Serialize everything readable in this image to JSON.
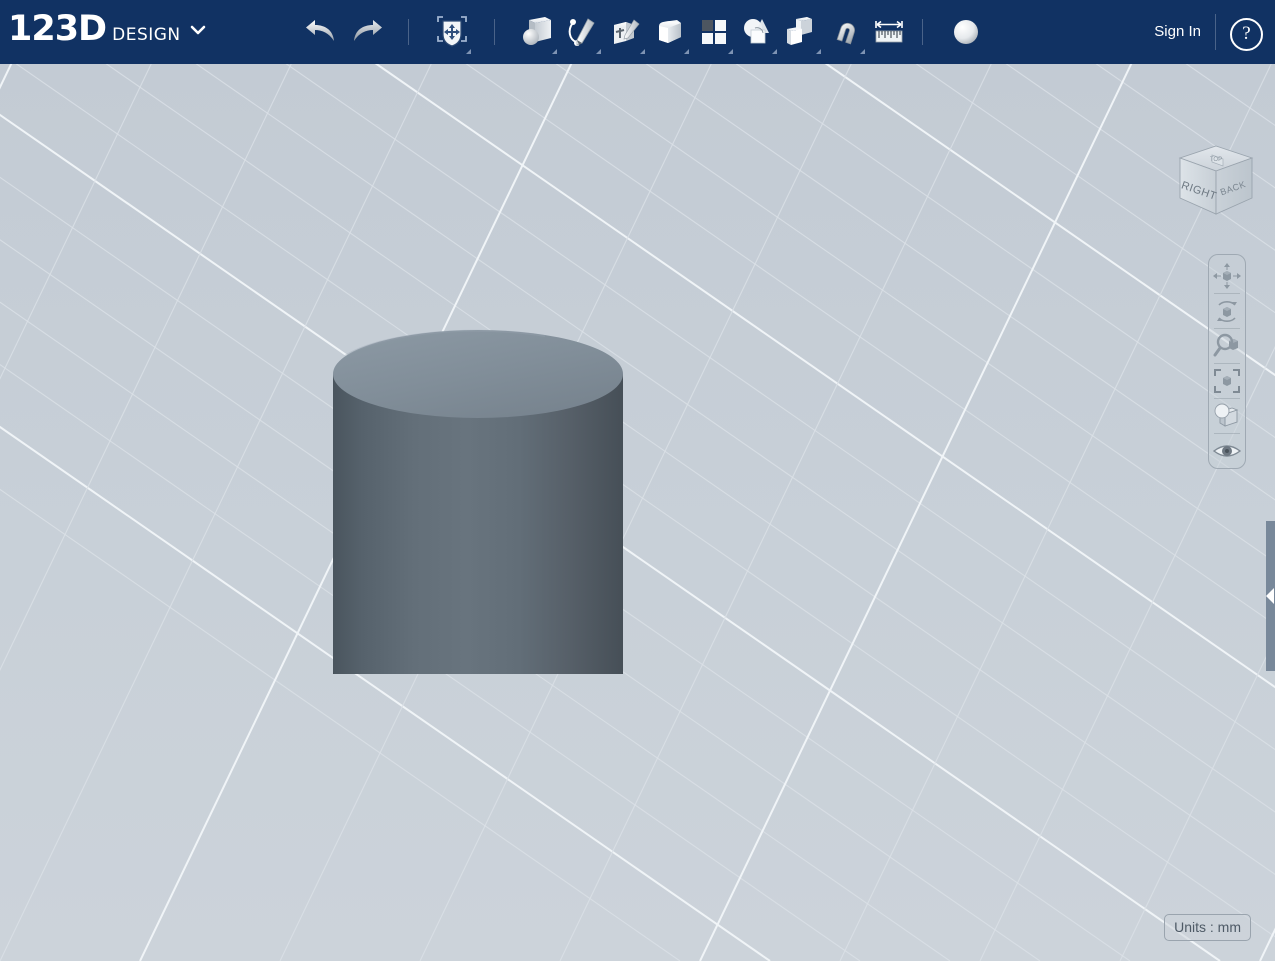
{
  "app": {
    "brand_primary": "123D",
    "brand_secondary": "DESIGN",
    "header_color": "#113263",
    "viewport_bg": "#c8d0d8"
  },
  "header": {
    "logo_menu_icon": "chevron-down-icon",
    "sign_in_label": "Sign In",
    "help_label": "?",
    "history": [
      {
        "name": "undo-button",
        "icon": "undo-arrow-icon",
        "label": "Undo"
      },
      {
        "name": "redo-button",
        "icon": "redo-arrow-icon",
        "label": "Redo"
      }
    ],
    "transform": [
      {
        "name": "transform-button",
        "icon": "move-transform-icon",
        "label": "Transform"
      }
    ],
    "tools": [
      {
        "name": "primitives-button",
        "icon": "primitives-icon",
        "label": "Primitives"
      },
      {
        "name": "sketch-button",
        "icon": "sketch-pencil-icon",
        "label": "Sketch"
      },
      {
        "name": "construct-button",
        "icon": "construct-icon",
        "label": "Construct"
      },
      {
        "name": "modify-button",
        "icon": "modify-box-icon",
        "label": "Modify"
      },
      {
        "name": "pattern-button",
        "icon": "pattern-grid-icon",
        "label": "Pattern"
      },
      {
        "name": "grouping-button",
        "icon": "grouping-shapes-icon",
        "label": "Grouping"
      },
      {
        "name": "combine-button",
        "icon": "combine-boxes-icon",
        "label": "Combine"
      },
      {
        "name": "snap-button",
        "icon": "magnet-snap-icon",
        "label": "Snap"
      },
      {
        "name": "measure-button",
        "icon": "ruler-measure-icon",
        "label": "Measure"
      }
    ],
    "material": [
      {
        "name": "material-button",
        "icon": "material-sphere-icon",
        "label": "Material"
      }
    ]
  },
  "viewcube": {
    "face_right": "RIGHT",
    "face_back": "BACK",
    "face_top": "TOP"
  },
  "navbar": {
    "items": [
      {
        "name": "pan-tool",
        "icon": "pan-arrows-icon",
        "label": "Pan"
      },
      {
        "name": "orbit-tool",
        "icon": "orbit-rotate-icon",
        "label": "Orbit"
      },
      {
        "name": "zoom-tool",
        "icon": "magnifier-zoom-icon",
        "label": "Zoom"
      },
      {
        "name": "fit-tool",
        "icon": "fit-to-view-icon",
        "label": "Fit"
      },
      {
        "name": "view-style-tool",
        "icon": "view-style-icon",
        "label": "View Style"
      },
      {
        "name": "visibility-tool",
        "icon": "eye-visibility-icon",
        "label": "Visibility"
      }
    ]
  },
  "status": {
    "units_label": "Units : mm"
  },
  "model": {
    "shape": "cylinder",
    "top_color": "#7f8d99",
    "body_color_light": "#68747e",
    "body_color_dark": "#4f5a63"
  },
  "panel": {
    "handle_icon": "collapse-left-arrow-icon"
  }
}
